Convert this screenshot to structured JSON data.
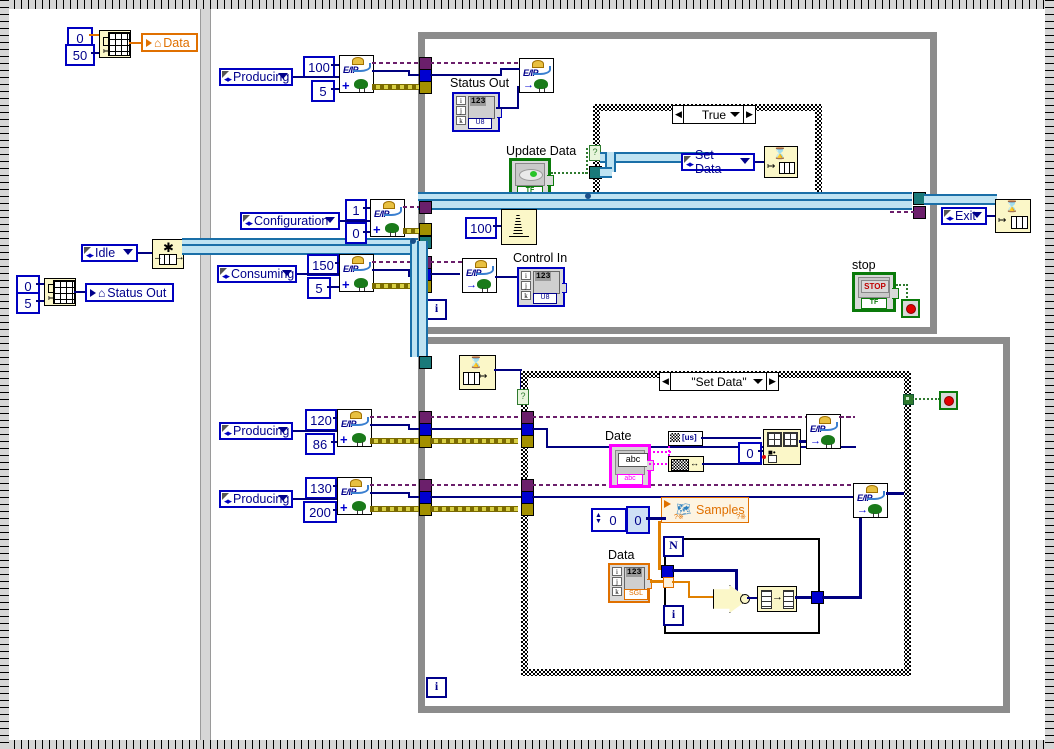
{
  "app": {
    "title": "LabVIEW Block Diagram"
  },
  "left_panel": {
    "data_init": {
      "constants": [
        "0",
        "50"
      ],
      "node_name": "initialize-array-icon",
      "indicator_label": "Data"
    },
    "status_init": {
      "constants": [
        "0",
        "5"
      ],
      "node_name": "initialize-array-icon",
      "indicator_label": "Status Out"
    },
    "state_enum": "Idle",
    "enqueue_node": "enqueue-element-icon"
  },
  "producer_loop": {
    "rows": [
      {
        "enum": "Producing",
        "const_top": "100",
        "const_bottom": "5",
        "vi": "E/IP"
      },
      {
        "enum": "Configuration",
        "const_top": "1",
        "const_bottom": "0",
        "vi": "E/IP"
      },
      {
        "enum": "Consuming",
        "const_top": "150",
        "const_bottom": "5",
        "vi": "E/IP"
      }
    ],
    "status_out_label": "Status Out",
    "status_out_repr": "U8",
    "control_in_label": "Control In",
    "control_in_repr": "U8",
    "update_data_label": "Update Data",
    "update_data_repr": "TF",
    "stop_label": "stop",
    "stop_button_text": "STOP",
    "stop_repr": "TF",
    "timeout_const": "100",
    "case": {
      "selector": "True",
      "ring": "Set Data",
      "node": "enqueue-element-icon"
    },
    "exit_ring": "Exit",
    "exit_node": "enqueue-element-icon",
    "iteration": "i"
  },
  "consumer_loop": {
    "dequeue_node": "dequeue-element-icon",
    "case_selector": "\"Set Data\"",
    "rows": [
      {
        "enum": "Producing",
        "const_top": "120",
        "const_bottom": "86",
        "vi": "E/IP"
      },
      {
        "enum": "Producing",
        "const_top": "130",
        "const_bottom": "200",
        "vi": "E/IP"
      }
    ],
    "date_label": "Date",
    "date_repr": "abc",
    "date_value": "abc",
    "timestamp_const": "0",
    "samples_label": "Samples",
    "data_label": "Data",
    "data_repr": "SGL",
    "loop_count_const": "0",
    "for_loop_N": "N",
    "for_loop_i": "i",
    "iteration": "i"
  },
  "colors": {
    "wire_blue": "#000080",
    "wire_cyan": "#1a6fa8",
    "wire_error": "#6b1f6b",
    "wire_yellow": "#d8cf45",
    "enum_blue": "#0000c0",
    "orange": "#e07000",
    "magenta": "#ff00ff",
    "green": "#0a7a0a",
    "node_cream": "#fbf7c8",
    "loop_grey": "#8c8c8c"
  }
}
